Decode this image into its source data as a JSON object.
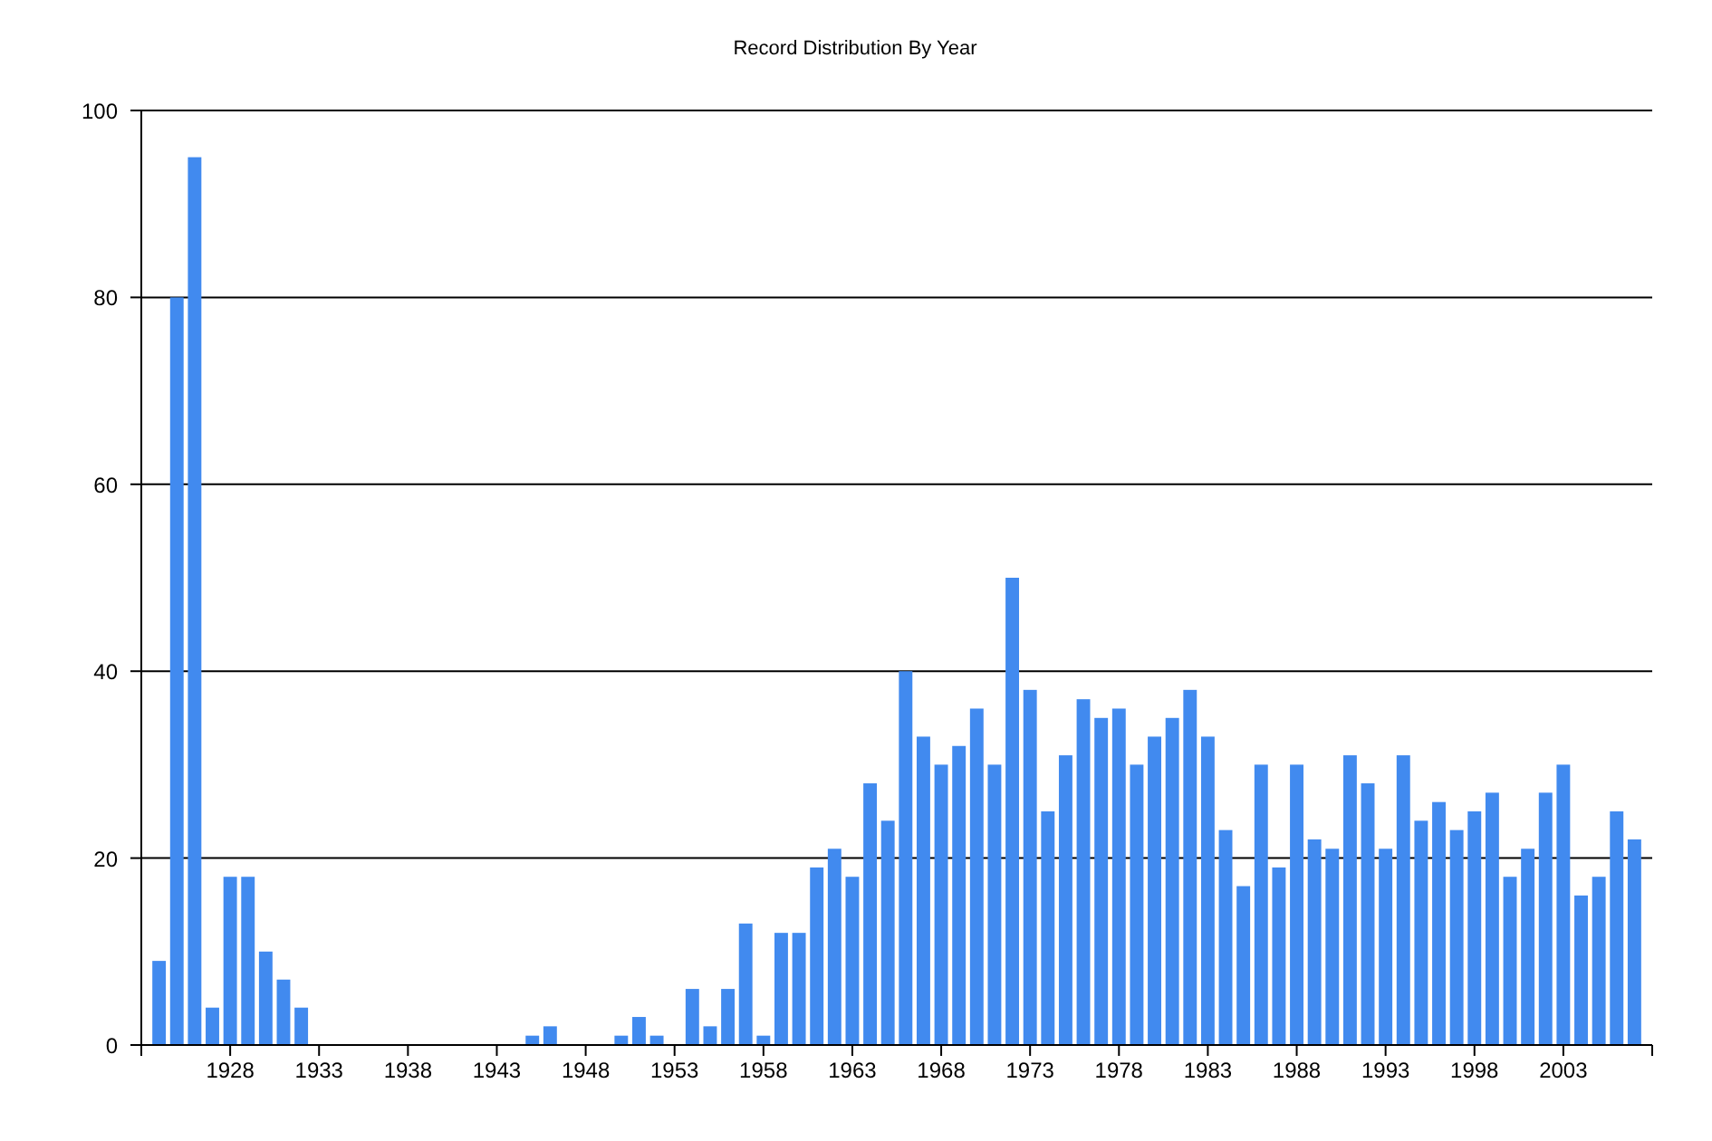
{
  "chart_data": {
    "type": "bar",
    "title": "Record Distribution By Year",
    "x": [
      1924,
      1925,
      1926,
      1927,
      1928,
      1929,
      1930,
      1931,
      1932,
      1933,
      1934,
      1935,
      1936,
      1937,
      1938,
      1939,
      1940,
      1941,
      1942,
      1943,
      1944,
      1945,
      1946,
      1947,
      1948,
      1949,
      1950,
      1951,
      1952,
      1953,
      1954,
      1955,
      1956,
      1957,
      1958,
      1959,
      1960,
      1961,
      1962,
      1963,
      1964,
      1965,
      1966,
      1967,
      1968,
      1969,
      1970,
      1971,
      1972,
      1973,
      1974,
      1975,
      1976,
      1977,
      1978,
      1979,
      1980,
      1981,
      1982,
      1983,
      1984,
      1985,
      1986,
      1987,
      1988,
      1989,
      1990,
      1991,
      1992,
      1993,
      1994,
      1995,
      1996,
      1997,
      1998,
      1999,
      2000,
      2001,
      2002,
      2003,
      2004,
      2005,
      2006,
      2007
    ],
    "values": [
      9,
      80,
      95,
      4,
      18,
      18,
      10,
      7,
      4,
      0,
      0,
      0,
      0,
      0,
      0,
      0,
      0,
      0,
      0,
      0,
      0,
      1,
      2,
      0,
      0,
      0,
      1,
      3,
      1,
      0,
      6,
      2,
      6,
      13,
      1,
      12,
      12,
      19,
      21,
      18,
      28,
      24,
      40,
      33,
      30,
      32,
      36,
      30,
      50,
      38,
      25,
      31,
      37,
      35,
      36,
      30,
      33,
      35,
      38,
      33,
      23,
      17,
      30,
      19,
      30,
      22,
      21,
      31,
      28,
      21,
      31,
      24,
      26,
      23,
      25,
      27,
      18,
      21,
      27,
      30,
      16,
      18,
      25,
      22
    ],
    "xlim": [
      1923,
      2008
    ],
    "ylim": [
      0,
      100
    ],
    "xticks": [
      1928,
      1933,
      1938,
      1943,
      1948,
      1953,
      1958,
      1963,
      1968,
      1973,
      1978,
      1983,
      1988,
      1993,
      1998,
      2003
    ],
    "yticks": [
      0,
      20,
      40,
      60,
      80,
      100
    ],
    "grid": true
  }
}
